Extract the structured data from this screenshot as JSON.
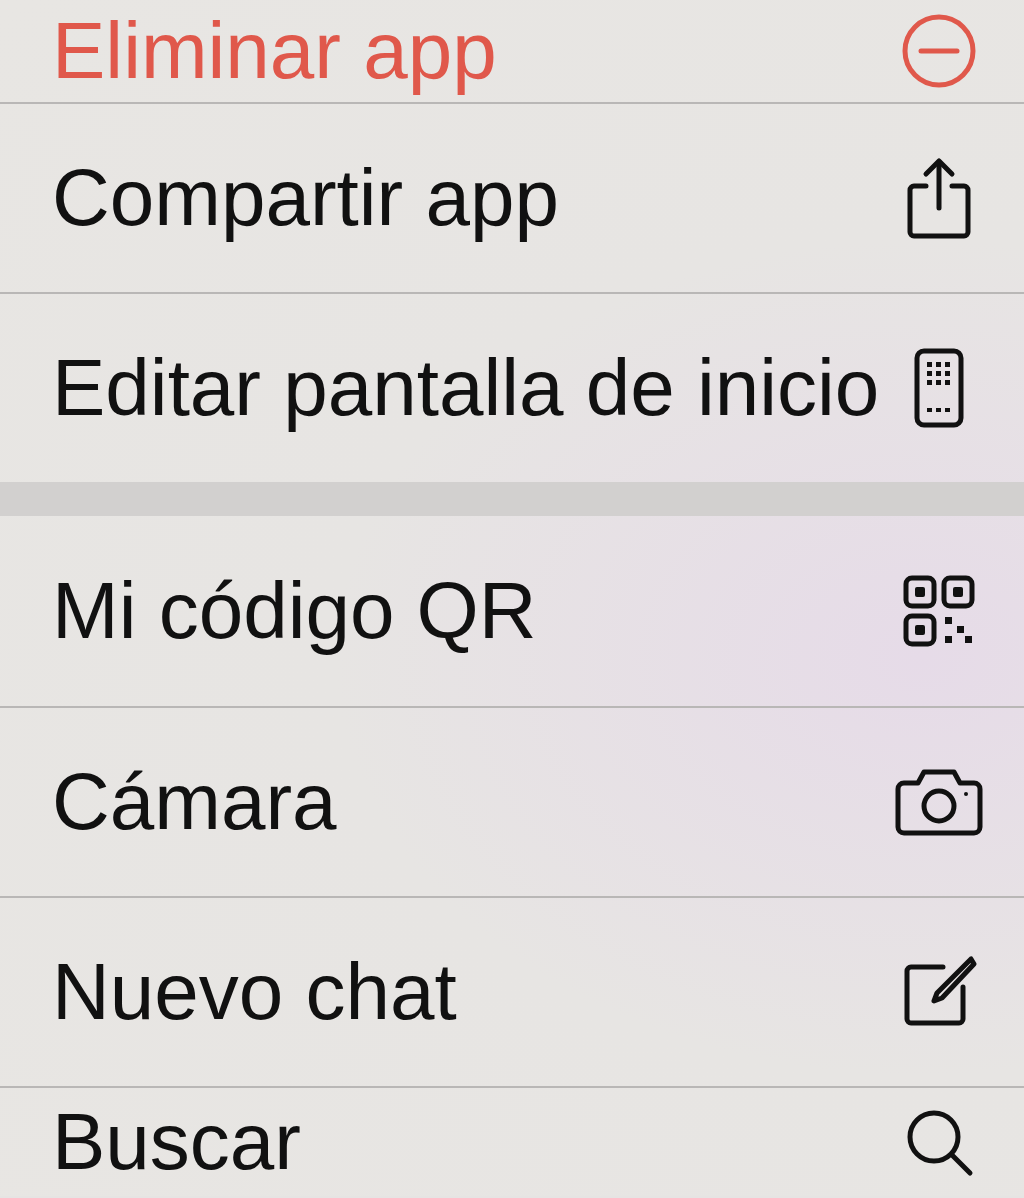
{
  "menu": {
    "groups": [
      {
        "items": [
          {
            "label": "Eliminar app",
            "kind": "destructive"
          },
          {
            "label": "Compartir app",
            "kind": "normal"
          },
          {
            "label": "Editar pantalla de inicio",
            "kind": "normal"
          }
        ]
      },
      {
        "items": [
          {
            "label": "Mi código QR",
            "kind": "normal"
          },
          {
            "label": "Cámara",
            "kind": "normal"
          },
          {
            "label": "Nuevo chat",
            "kind": "normal"
          },
          {
            "label": "Buscar",
            "kind": "normal"
          }
        ]
      }
    ]
  }
}
